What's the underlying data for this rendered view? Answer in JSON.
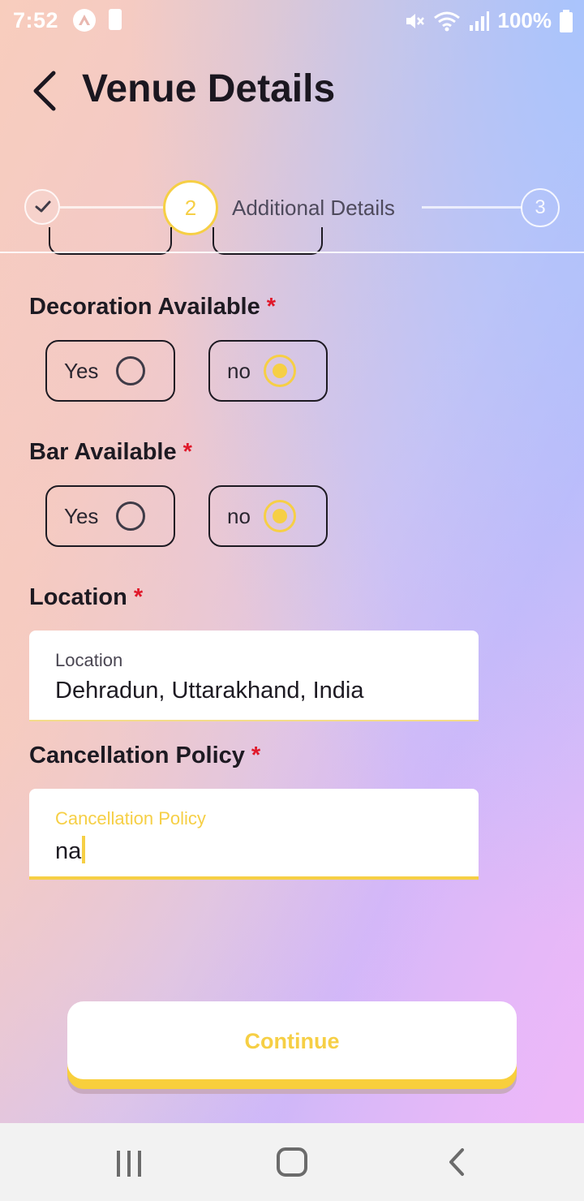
{
  "status_bar": {
    "time": "7:52",
    "battery_percent": "100%"
  },
  "header": {
    "title": "Venue Details"
  },
  "stepper": {
    "current_step_number": "2",
    "current_step_label": "Additional Details",
    "next_step_number": "3"
  },
  "fields": {
    "decoration": {
      "label": "Decoration Available",
      "required_mark": "*",
      "options": [
        "Yes",
        "no"
      ],
      "selected": "no"
    },
    "bar": {
      "label": "Bar Available",
      "required_mark": "*",
      "options": [
        "Yes",
        "no"
      ],
      "selected": "no"
    },
    "location": {
      "label": "Location",
      "required_mark": "*",
      "input_label": "Location",
      "value": "Dehradun, Uttarakhand, India"
    },
    "cancellation": {
      "label": "Cancellation Policy",
      "required_mark": "*",
      "input_label": "Cancellation Policy",
      "value": "na"
    }
  },
  "actions": {
    "continue_label": "Continue"
  },
  "colors": {
    "accent": "#f6cf45",
    "required": "#e0182a",
    "text_dark": "#1d1a22"
  }
}
